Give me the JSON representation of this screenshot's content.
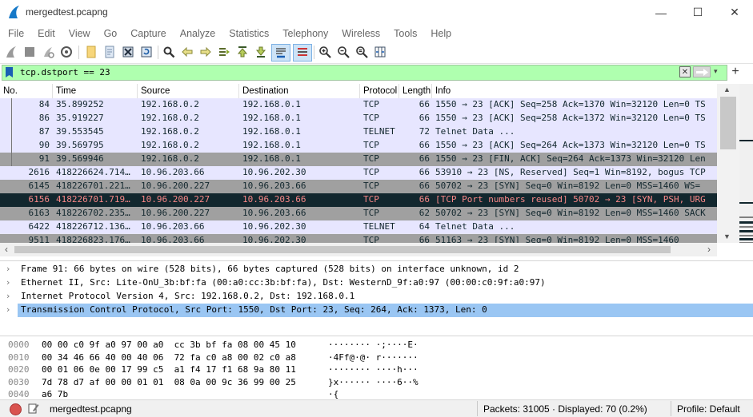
{
  "window": {
    "title": "mergedtest.pcapng",
    "minimize_glyph": "—",
    "maximize_glyph": "☐",
    "close_glyph": "✕"
  },
  "menu": [
    "File",
    "Edit",
    "View",
    "Go",
    "Capture",
    "Analyze",
    "Statistics",
    "Telephony",
    "Wireless",
    "Tools",
    "Help"
  ],
  "toolbar": {
    "icons": [
      "shark-fin-start-icon",
      "stop-icon",
      "restart-icon",
      "capture-options-icon",
      "open-file-icon",
      "open-recent-icon",
      "close-file-icon",
      "reload-icon",
      "find-icon",
      "go-back-icon",
      "go-forward-icon",
      "go-to-packet-icon",
      "first-packet-icon",
      "last-packet-icon",
      "autoscroll-icon",
      "colorize-icon",
      "zoom-in-icon",
      "zoom-out-icon",
      "normal-size-icon",
      "resize-columns-icon"
    ]
  },
  "filter": {
    "value": "tcp.dstport == 23",
    "background": "#afffaf"
  },
  "packet_list": {
    "columns": [
      "No.",
      "Time",
      "Source",
      "Destination",
      "Protocol",
      "Length",
      "Info"
    ],
    "rows": [
      {
        "no": "84",
        "time": "35.899252",
        "src": "192.168.0.2",
        "dst": "192.168.0.1",
        "proto": "TCP",
        "len": "66",
        "info": "1550 → 23 [ACK] Seq=258 Ack=1370 Win=32120 Len=0 TS",
        "bg": "#e7e6ff",
        "fg": "#12272e"
      },
      {
        "no": "86",
        "time": "35.919227",
        "src": "192.168.0.2",
        "dst": "192.168.0.1",
        "proto": "TCP",
        "len": "66",
        "info": "1550 → 23 [ACK] Seq=258 Ack=1372 Win=32120 Len=0 TS",
        "bg": "#e7e6ff",
        "fg": "#12272e"
      },
      {
        "no": "87",
        "time": "39.553545",
        "src": "192.168.0.2",
        "dst": "192.168.0.1",
        "proto": "TELNET",
        "len": "72",
        "info": "Telnet Data ...",
        "bg": "#e7e6ff",
        "fg": "#12272e"
      },
      {
        "no": "90",
        "time": "39.569795",
        "src": "192.168.0.2",
        "dst": "192.168.0.1",
        "proto": "TCP",
        "len": "66",
        "info": "1550 → 23 [ACK] Seq=264 Ack=1373 Win=32120 Len=0 TS",
        "bg": "#e7e6ff",
        "fg": "#12272e"
      },
      {
        "no": "91",
        "time": "39.569946",
        "src": "192.168.0.2",
        "dst": "192.168.0.1",
        "proto": "TCP",
        "len": "66",
        "info": "1550 → 23 [FIN, ACK] Seq=264 Ack=1373 Win=32120 Len",
        "bg": "#a0a0a0",
        "fg": "#12272e"
      },
      {
        "no": "2616",
        "time": "418226624.714…",
        "src": "10.96.203.66",
        "dst": "10.96.202.30",
        "proto": "TCP",
        "len": "66",
        "info": "53910 → 23 [NS, Reserved] Seq=1 Win=8192, bogus TCP",
        "bg": "#e7e6ff",
        "fg": "#12272e"
      },
      {
        "no": "6145",
        "time": "418226701.221…",
        "src": "10.96.200.227",
        "dst": "10.96.203.66",
        "proto": "TCP",
        "len": "66",
        "info": "50702 → 23 [SYN] Seq=0 Win=8192 Len=0 MSS=1460 WS=",
        "bg": "#a0a0a0",
        "fg": "#12272e"
      },
      {
        "no": "6156",
        "time": "418226701.719…",
        "src": "10.96.200.227",
        "dst": "10.96.203.66",
        "proto": "TCP",
        "len": "66",
        "info": "[TCP Port numbers reused] 50702 → 23 [SYN, PSH, URG",
        "bg": "#12272e",
        "fg": "#f78787"
      },
      {
        "no": "6163",
        "time": "418226702.235…",
        "src": "10.96.200.227",
        "dst": "10.96.203.66",
        "proto": "TCP",
        "len": "62",
        "info": "50702 → 23 [SYN] Seq=0 Win=8192 Len=0 MSS=1460 SACK",
        "bg": "#a0a0a0",
        "fg": "#12272e"
      },
      {
        "no": "6422",
        "time": "418226712.136…",
        "src": "10.96.203.66",
        "dst": "10.96.202.30",
        "proto": "TELNET",
        "len": "64",
        "info": "Telnet Data ...",
        "bg": "#e7e6ff",
        "fg": "#12272e"
      },
      {
        "no": "9511",
        "time": "418226823.176…",
        "src": "10.96.203.66",
        "dst": "10.96.202.30",
        "proto": "TCP",
        "len": "66",
        "info": "51163 → 23 [SYN] Seq=0 Win=8192 Len=0 MSS=1460",
        "bg": "#a0a0a0",
        "fg": "#12272e"
      }
    ]
  },
  "details": [
    "Frame 91: 66 bytes on wire (528 bits), 66 bytes captured (528 bits) on interface unknown, id 2",
    "Ethernet II, Src: Lite-OnU_3b:bf:fa (00:a0:cc:3b:bf:fa), Dst: WesternD_9f:a0:97 (00:00:c0:9f:a0:97)",
    "Internet Protocol Version 4, Src: 192.168.0.2, Dst: 192.168.0.1",
    "Transmission Control Protocol, Src Port: 1550, Dst Port: 23, Seq: 264, Ack: 1373, Len: 0"
  ],
  "bytes": [
    {
      "off": "0000",
      "hex": "00 00 c0 9f a0 97 00 a0  cc 3b bf fa 08 00 45 10",
      "ascii": "········ ·;····E·"
    },
    {
      "off": "0010",
      "hex": "00 34 46 66 40 00 40 06  72 fa c0 a8 00 02 c0 a8",
      "ascii": "·4Ff@·@· r·······"
    },
    {
      "off": "0020",
      "hex": "00 01 06 0e 00 17 99 c5  a1 f4 17 f1 68 9a 80 11",
      "ascii": "········ ····h···"
    },
    {
      "off": "0030",
      "hex": "7d 78 d7 af 00 00 01 01  08 0a 00 9c 36 99 00 25",
      "ascii": "}x······ ····6··%"
    },
    {
      "off": "0040",
      "hex": "a6 7b",
      "ascii": "·{"
    }
  ],
  "status": {
    "file": "mergedtest.pcapng",
    "packets": "Packets: 31005 · Displayed: 70 (0.2%)",
    "profile": "Profile: Default"
  },
  "colors": {
    "selected_detail": "#9ac6f3",
    "filter_valid": "#afffaf"
  }
}
